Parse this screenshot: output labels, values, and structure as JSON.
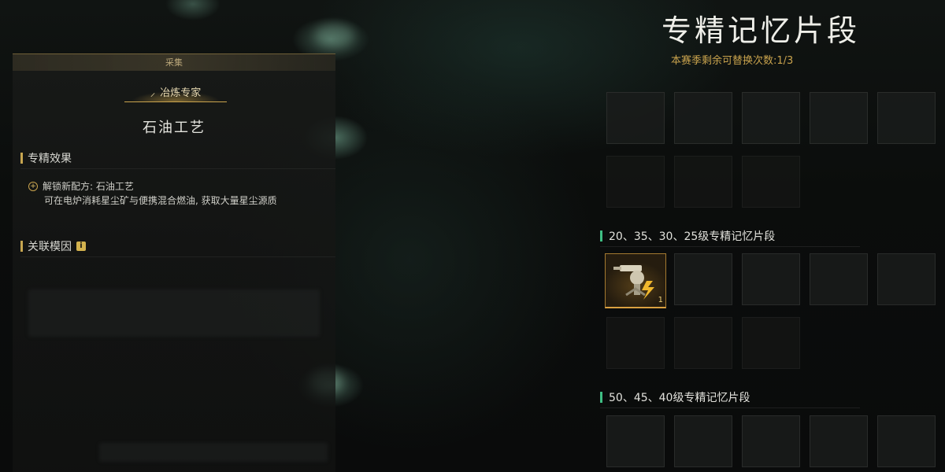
{
  "colors": {
    "accent_gold": "#c9a34d",
    "tier_marker_green": "#3fbf84",
    "text_primary": "#e4e4de",
    "background": "#0b0d0c"
  },
  "detail_panel": {
    "category_label": "采集",
    "skill_tag": {
      "icon": "pickaxe-icon",
      "label": "冶炼专家"
    },
    "recipe_title": "石油工艺",
    "effect_section": {
      "heading": "专精效果",
      "unlock_line": "解锁新配方: 石油工艺",
      "description": "可在电炉消耗星尘矿与便携混合燃油, 获取大量星尘源质"
    },
    "linked_section": {
      "heading": "关联模因",
      "info_icon": "info-icon"
    }
  },
  "memory_panel": {
    "title": "专精记忆片段",
    "season_remaining": "本赛季剩余可替换次数:1/3",
    "tiers": [
      {
        "label": "20、35、30、25级专精记忆片段"
      },
      {
        "label": "50、45、40级专精记忆片段"
      }
    ],
    "equipped_item": {
      "icon": "turret-fragment-icon",
      "count": "1"
    }
  }
}
